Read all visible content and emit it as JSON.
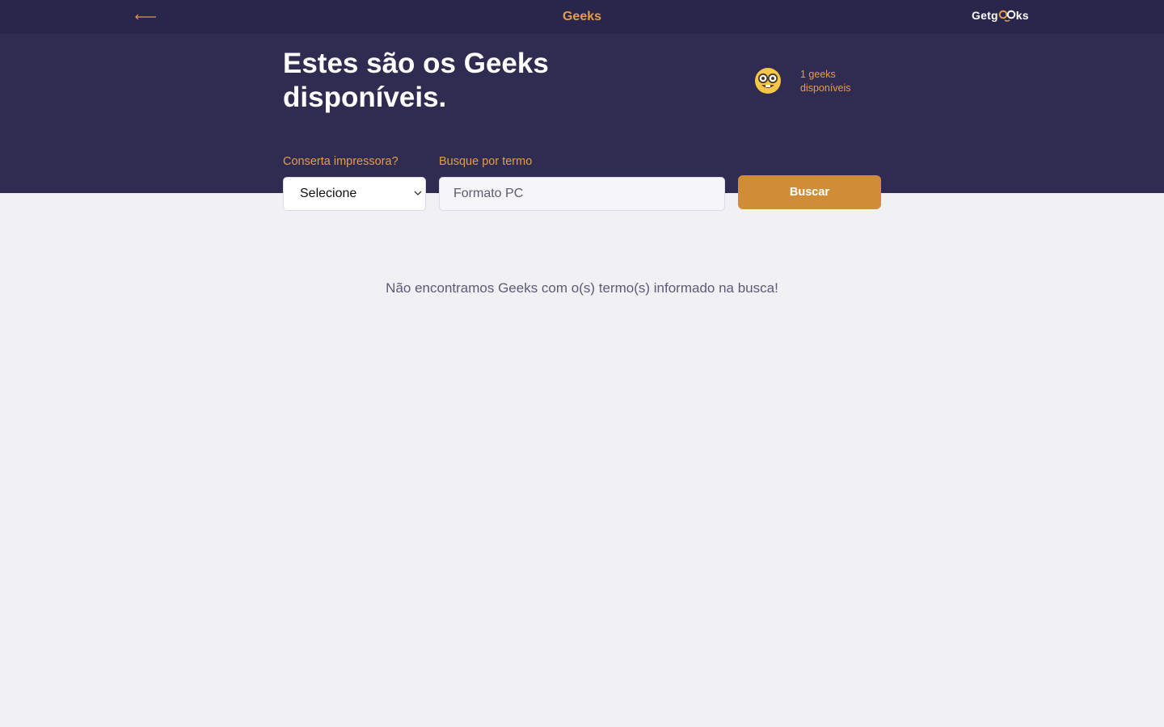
{
  "header": {
    "title": "Geeks",
    "logo_text_before": "Getg",
    "logo_text_after": "ks",
    "back_icon": "arrow-left-icon"
  },
  "hero": {
    "title_line1": "Estes são os Geeks",
    "title_line2": "disponíveis.",
    "emoji_icon": "nerd-face-icon",
    "count_line1": "1 geeks",
    "count_line2": "disponíveis"
  },
  "filters": {
    "printer_label": "Conserta impressora?",
    "printer_selected": "Selecione",
    "term_label": "Busque por termo",
    "term_value": "Formato PC",
    "search_button": "Buscar"
  },
  "results": {
    "empty_message": "Não encontramos Geeks com o(s) termo(s) informado na busca!"
  },
  "colors": {
    "topbar": "#28264a",
    "hero": "#302c51",
    "accent": "#e59c4a",
    "button": "#d08d37",
    "background": "#f0f0f5"
  }
}
